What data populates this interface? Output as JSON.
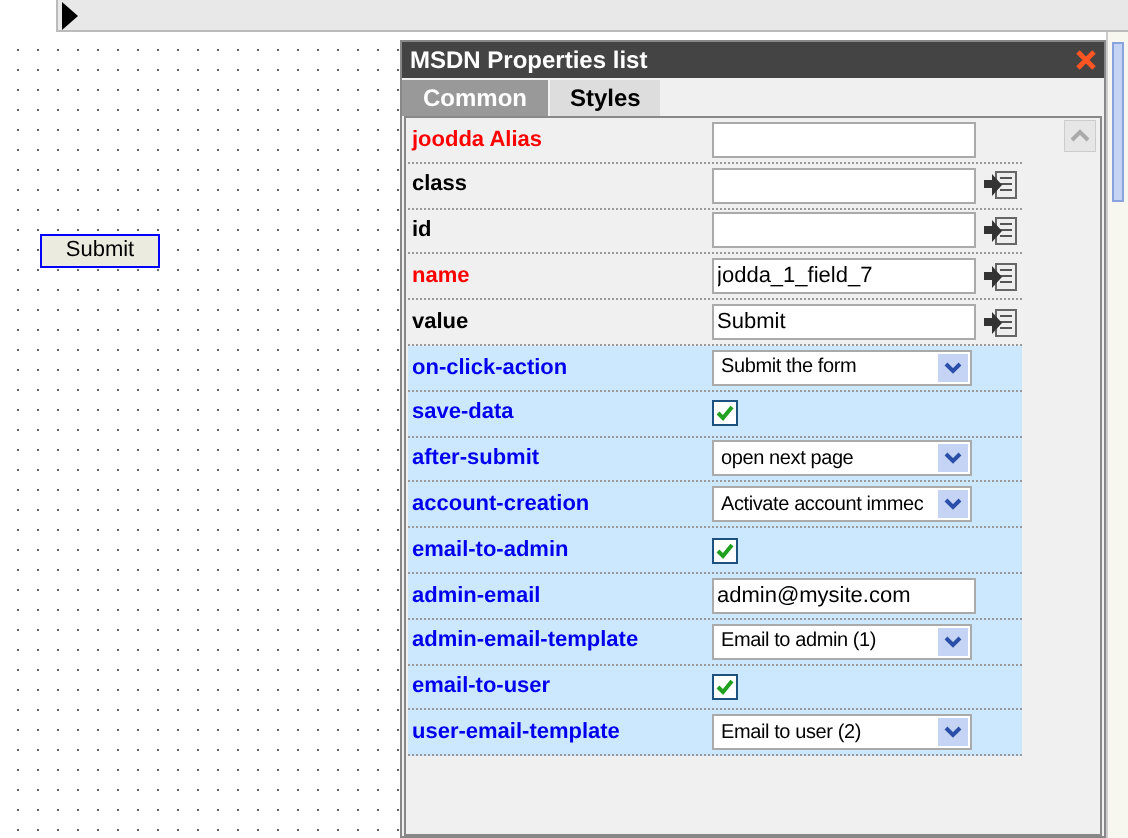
{
  "panel": {
    "title": "MSDN Properties list"
  },
  "canvas": {
    "button_label": "Submit"
  },
  "tabs": [
    {
      "label": "Common",
      "selected": true
    },
    {
      "label": "Styles",
      "selected": false
    }
  ],
  "properties": [
    {
      "label": "joodda Alias",
      "kind": "text",
      "required": true,
      "highlighted": false,
      "picker": false
    },
    {
      "label": "class",
      "kind": "text",
      "required": false,
      "highlighted": false,
      "picker": true
    },
    {
      "label": "id",
      "kind": "text",
      "required": false,
      "highlighted": false,
      "picker": true
    },
    {
      "label": "name",
      "kind": "text",
      "value": "jodda_1_field_7",
      "required": true,
      "highlighted": false,
      "picker": true
    },
    {
      "label": "value",
      "kind": "text",
      "value": "Submit",
      "required": false,
      "highlighted": false,
      "picker": true
    },
    {
      "label": "on-click-action",
      "kind": "select",
      "value": "Submit the form",
      "required": false,
      "highlighted": true,
      "picker": false
    },
    {
      "label": "save-data",
      "kind": "checkbox",
      "checked": true,
      "required": false,
      "highlighted": true,
      "picker": false
    },
    {
      "label": "after-submit",
      "kind": "select",
      "value": "open next page",
      "required": false,
      "highlighted": true,
      "picker": false
    },
    {
      "label": "account-creation",
      "kind": "select",
      "value": "Activate account immec",
      "required": false,
      "highlighted": true,
      "picker": false
    },
    {
      "label": "email-to-admin",
      "kind": "checkbox",
      "checked": true,
      "required": false,
      "highlighted": true,
      "picker": false
    },
    {
      "label": "admin-email",
      "kind": "text",
      "value": "admin@mysite.com",
      "required": false,
      "highlighted": true,
      "picker": false
    },
    {
      "label": "admin-email-template",
      "kind": "select",
      "value": "Email to admin (1)",
      "required": false,
      "highlighted": true,
      "picker": false
    },
    {
      "label": "email-to-user",
      "kind": "checkbox",
      "checked": true,
      "required": false,
      "highlighted": true,
      "picker": false
    },
    {
      "label": "user-email-template",
      "kind": "select",
      "value": "Email to user (2)",
      "required": false,
      "highlighted": true,
      "picker": false
    }
  ]
}
